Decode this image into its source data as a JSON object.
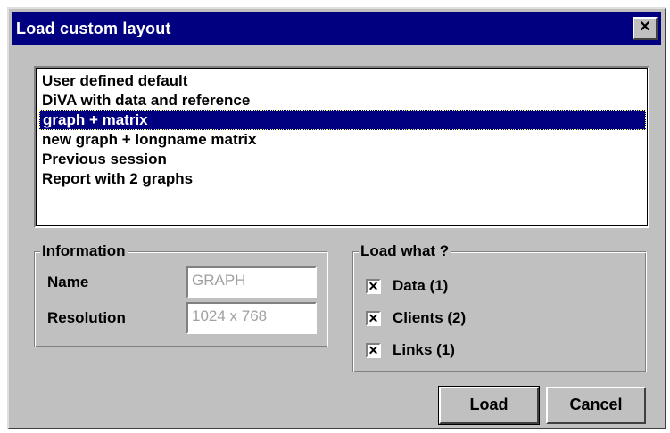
{
  "window": {
    "title": "Load custom layout",
    "close_glyph": "✕"
  },
  "layouts": {
    "items": [
      "User defined default",
      "DiVA with data and reference",
      "graph + matrix",
      "new graph + longname matrix",
      "Previous session",
      "Report with 2 graphs"
    ],
    "selected_index": 2
  },
  "information": {
    "group_label": "Information",
    "name_label": "Name",
    "name_value": "GRAPH",
    "resolution_label": "Resolution",
    "resolution_value": "1024 x 768"
  },
  "load_what": {
    "group_label": "Load what ?",
    "options": [
      {
        "label": "Data (1)",
        "checked": true
      },
      {
        "label": "Clients (2)",
        "checked": true
      },
      {
        "label": "Links (1)",
        "checked": true
      }
    ]
  },
  "buttons": {
    "load": "Load",
    "cancel": "Cancel"
  },
  "colors": {
    "titlebar": "#000080",
    "face": "#c0c0c0",
    "selection": "#000080"
  }
}
